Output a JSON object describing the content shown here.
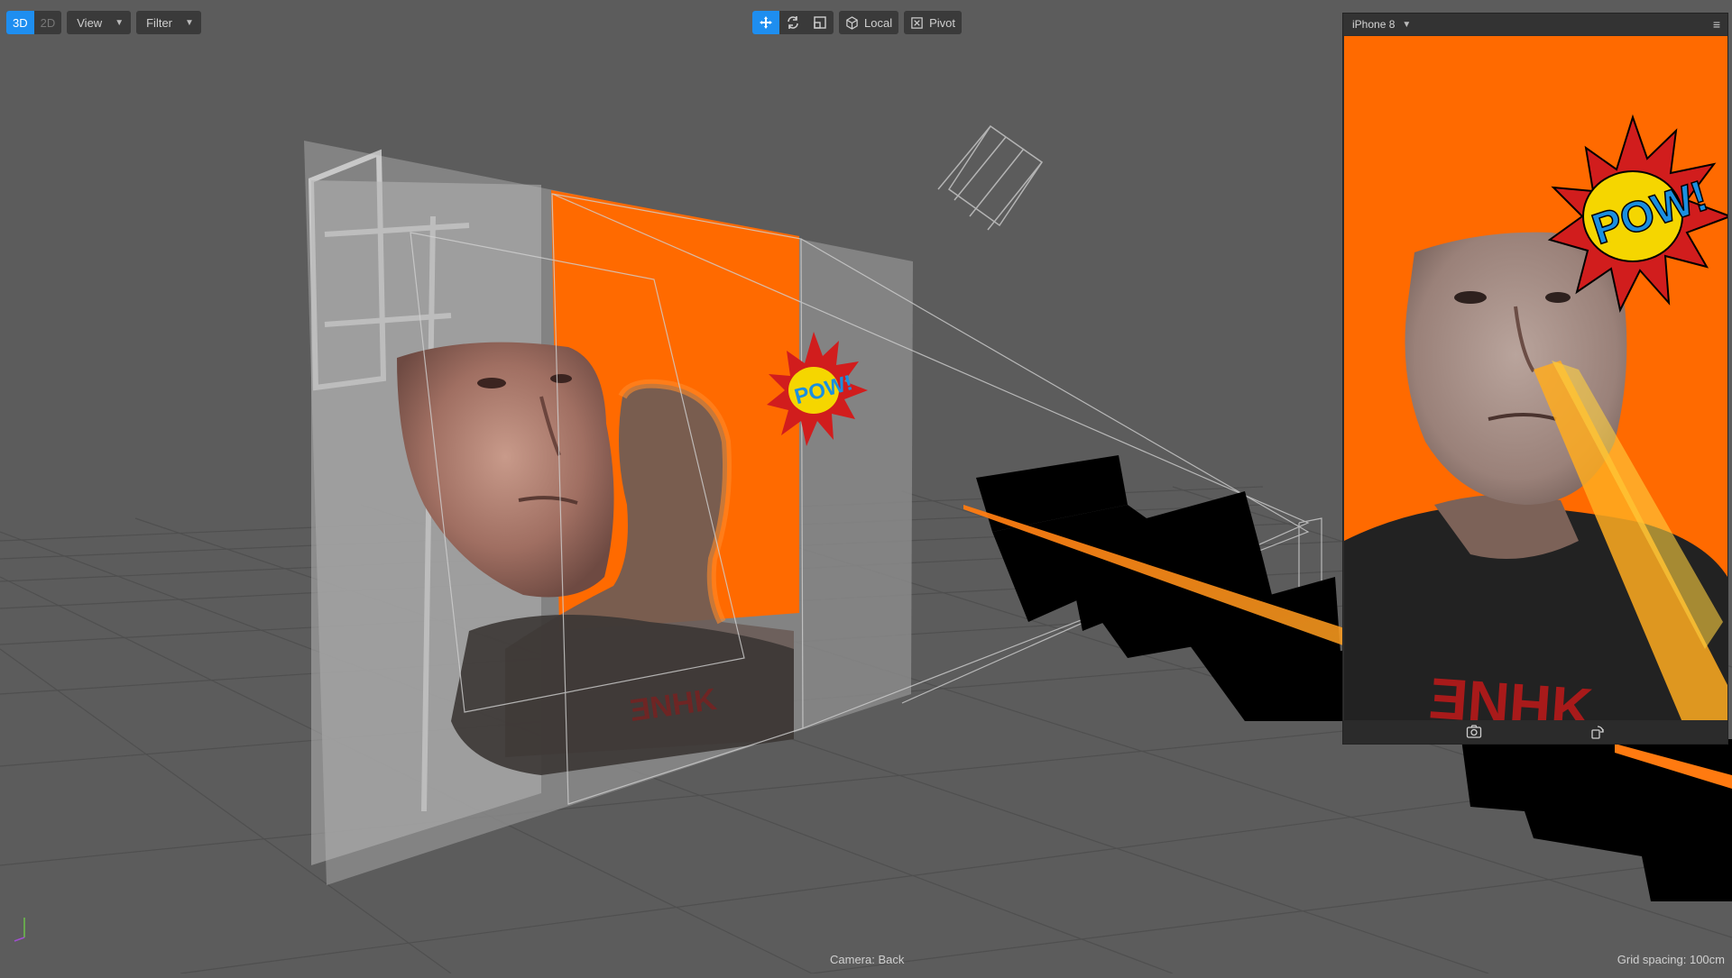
{
  "toolbar": {
    "mode_3d": "3D",
    "mode_2d": "2D",
    "view_label": "View",
    "filter_label": "Filter",
    "transform": {
      "move_icon": "move-icon",
      "rotate_icon": "rotate-icon",
      "scale_icon": "scale-icon",
      "local_label": "Local",
      "pivot_label": "Pivot"
    }
  },
  "preview": {
    "device": "iPhone 8",
    "menu_icon": "hamburger-icon",
    "footer_icons": [
      "screenshot-icon",
      "rotate-device-icon"
    ]
  },
  "scene": {
    "sticker_text": "POW!"
  },
  "status": {
    "camera": "Camera: Back",
    "grid": "Grid spacing: 100cm"
  },
  "colors": {
    "accent": "#1e8ef0",
    "background_orange": "#ff6a00",
    "viewport_bg": "#5c5c5c"
  }
}
